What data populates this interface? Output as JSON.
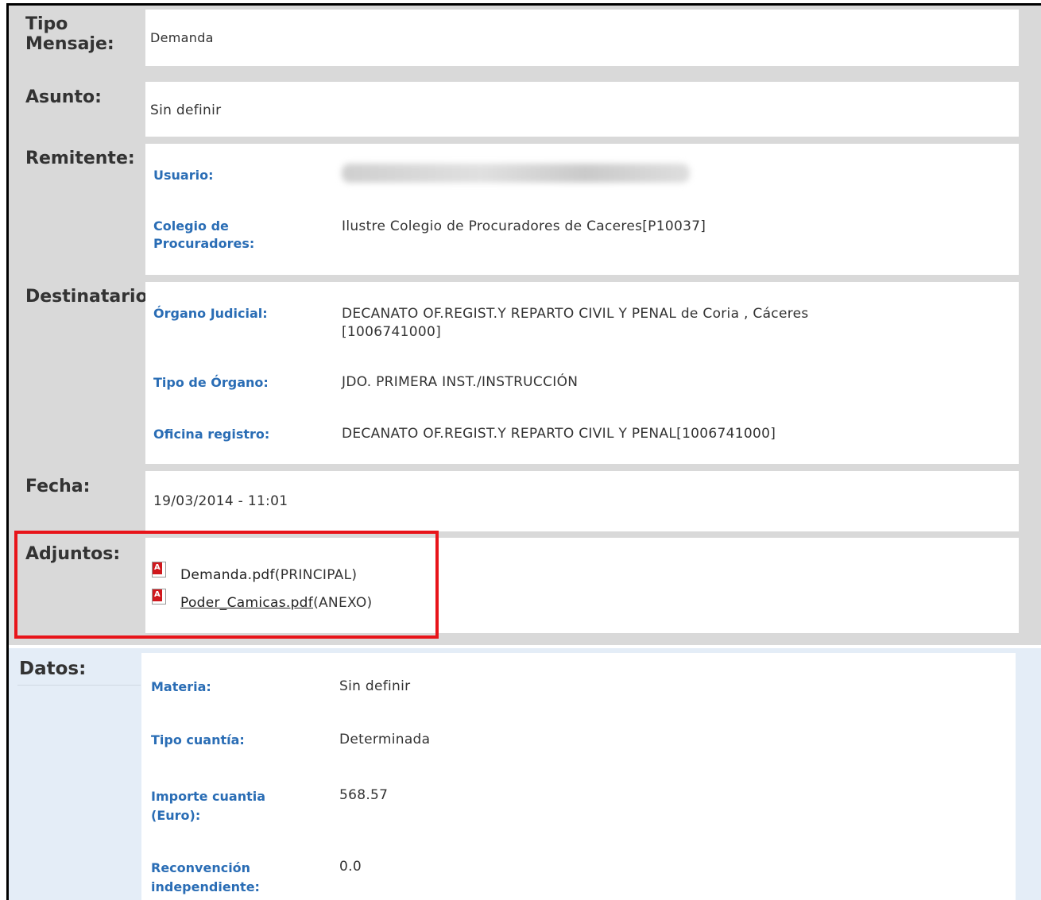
{
  "labels": {
    "tipo_mensaje": "Tipo\nMensaje:",
    "asunto": "Asunto:",
    "remitente": "Remitente:",
    "destinatario": "Destinatario",
    "fecha": "Fecha:",
    "adjuntos": "Adjuntos:",
    "datos": "Datos:"
  },
  "tipo_mensaje_value": "Demanda",
  "asunto_value": "Sin definir",
  "remitente": {
    "usuario_label": "Usuario:",
    "colegio_label": "Colegio de\nProcuradores:",
    "colegio_value": "Ilustre Colegio de Procuradores de Caceres[P10037]"
  },
  "destinatario": {
    "organo_label": "Órgano Judicial:",
    "organo_value": "DECANATO OF.REGIST.Y REPARTO CIVIL Y PENAL de Coria , Cáceres\n[1006741000]",
    "tipo_organo_label": "Tipo de Órgano:",
    "tipo_organo_value": "JDO. PRIMERA INST./INSTRUCCIÓN",
    "oficina_label": "Oficina registro:",
    "oficina_value": "DECANATO OF.REGIST.Y REPARTO CIVIL Y PENAL[1006741000]"
  },
  "fecha_value": "19/03/2014 - 11:01",
  "adjuntos": [
    {
      "name": "Demanda.pdf",
      "type": "(PRINCIPAL)",
      "icon": "pdf-icon"
    },
    {
      "name": "Poder_Camicas.pdf",
      "type": "(ANEXO)",
      "icon": "pdf-icon"
    }
  ],
  "datos": {
    "materia_label": "Materia:",
    "materia_value": "Sin definir",
    "tipo_cuantia_label": "Tipo cuantía:",
    "tipo_cuantia_value": "Determinada",
    "importe_label": "Importe cuantia\n(Euro):",
    "importe_value": "568.57",
    "reconvencion_label": "Reconvención\nindependiente:",
    "reconvencion_value": "0.0"
  },
  "colors": {
    "highlight_box": "#e8141a",
    "label_blue": "#2a6db5",
    "upper_bg": "#d9d9d9",
    "lower_bg": "#e4edf7"
  }
}
